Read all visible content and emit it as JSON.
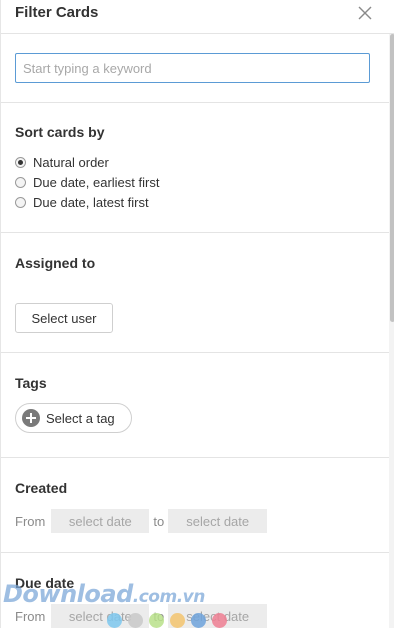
{
  "header": {
    "title": "Filter Cards"
  },
  "keyword": {
    "placeholder": "Start typing a keyword",
    "value": ""
  },
  "sort": {
    "title": "Sort cards by",
    "options": [
      {
        "label": "Natural order",
        "checked": true
      },
      {
        "label": "Due date, earliest first",
        "checked": false
      },
      {
        "label": "Due date, latest first",
        "checked": false
      }
    ]
  },
  "assigned": {
    "title": "Assigned to",
    "button_label": "Select user"
  },
  "tags": {
    "title": "Tags",
    "button_label": "Select a tag",
    "icon": "plus-circle-icon"
  },
  "created": {
    "title": "Created",
    "from_label": "From",
    "to_label": "to",
    "from_placeholder": "select date",
    "to_placeholder": "select date"
  },
  "due_date": {
    "title": "Due date",
    "from_label": "From",
    "to_label": "to",
    "from_placeholder": "select date",
    "to_placeholder": "select date"
  },
  "watermark": {
    "text": "Download",
    "suffix": ".com.vn",
    "dot_colors": [
      "#7ec8ee",
      "#c9c9c9",
      "#b9e08a",
      "#f3c46e",
      "#6ea3dc",
      "#ef7f93"
    ]
  },
  "colors": {
    "input_focus_border": "#5b9bd5",
    "date_box_bg": "#ececec",
    "divider": "#e4e4e4"
  }
}
